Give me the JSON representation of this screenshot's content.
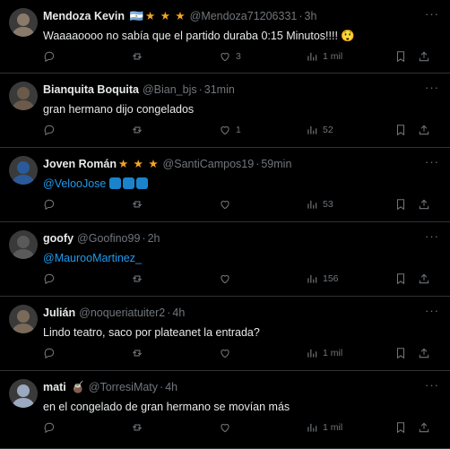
{
  "tweets": [
    {
      "name": "Mendoza Kevin",
      "flag": "🇦🇷",
      "badges": "★ ★ ★",
      "handle": "@Mendoza71206331",
      "time": "3h",
      "text": "Waaaaoooo no sabía que el partido duraba 0:15 Minutos!!!! 😲",
      "mention": "",
      "emojis": 0,
      "likes": "3",
      "views": "1 mil",
      "avatar_color": "#8a7a6a"
    },
    {
      "name": "Bianquita Boquita",
      "flag": "",
      "badges": "",
      "handle": "@Bian_bjs",
      "time": "31min",
      "text": "gran hermano dijo congelados",
      "mention": "",
      "emojis": 0,
      "likes": "1",
      "views": "52",
      "avatar_color": "#6b5a4a"
    },
    {
      "name": "Joven Román",
      "flag": "",
      "badges": "★ ★ ★",
      "handle": "@SantiCampos19",
      "time": "59min",
      "text": "",
      "mention": "@VelooJose",
      "emojis": 3,
      "likes": "",
      "views": "53",
      "avatar_color": "#2a5a9a"
    },
    {
      "name": "goofy",
      "flag": "",
      "badges": "",
      "handle": "@Goofino99",
      "time": "2h",
      "text": "",
      "mention": "@MaurooMartinez_",
      "emojis": 0,
      "likes": "",
      "views": "156",
      "avatar_color": "#5a5a5a"
    },
    {
      "name": "Julián",
      "flag": "",
      "badges": "",
      "handle": "@noqueriatuiter2",
      "time": "4h",
      "text": "Lindo teatro, saco por plateanet la entrada?",
      "mention": "",
      "emojis": 0,
      "likes": "",
      "views": "1 mil",
      "avatar_color": "#7a6a5a"
    },
    {
      "name": "mati",
      "flag": "🧉",
      "badges": "",
      "handle": "@TorresiMaty",
      "time": "4h",
      "text": "en el congelado de gran hermano se movían más",
      "mention": "",
      "emojis": 0,
      "likes": "",
      "views": "1 mil",
      "avatar_color": "#9aa8c0"
    }
  ],
  "dot": "·",
  "more": "···",
  "colors": {
    "accent": "#1d9bf0",
    "muted": "#71767b",
    "border": "#2f3336",
    "star": "#f5a623"
  }
}
